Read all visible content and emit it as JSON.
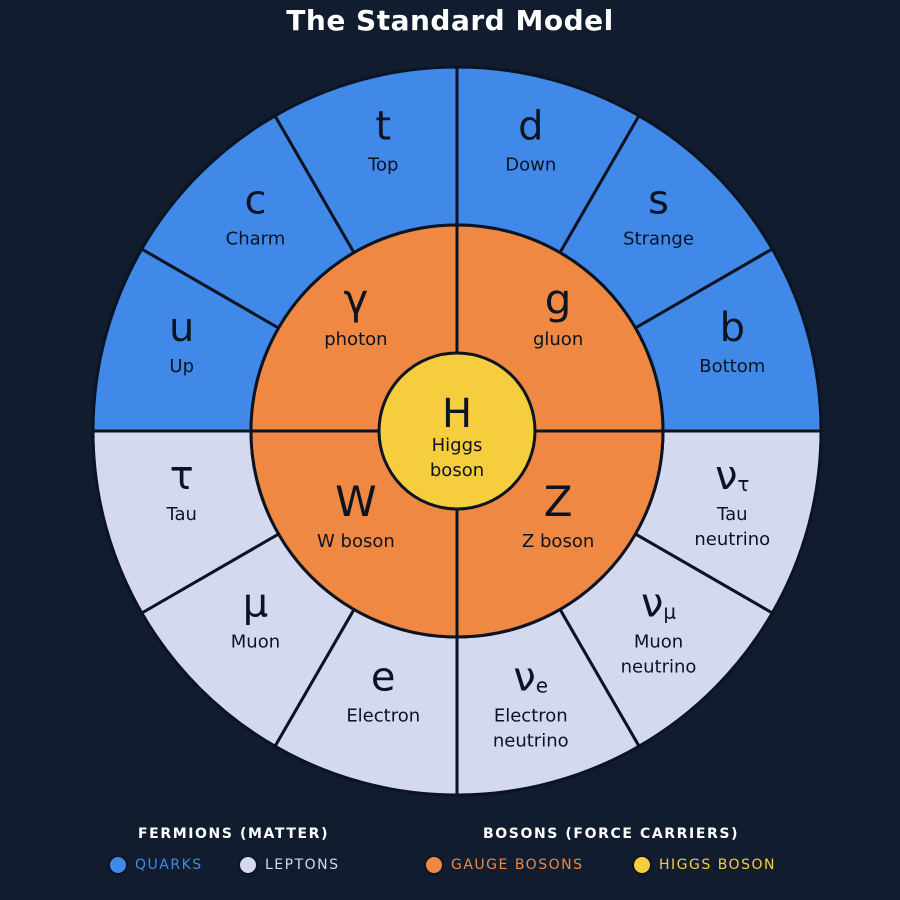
{
  "title": "The Standard Model",
  "colors": {
    "background": "#111d2e",
    "quark": "#4189e8",
    "lepton": "#d4d9f0",
    "gauge": "#ef8843",
    "higgs": "#f6cd3d",
    "stroke": "#0b1422",
    "text": "#0b1422"
  },
  "quarks": [
    {
      "symbol": "u",
      "sub": "",
      "name": [
        "Up"
      ]
    },
    {
      "symbol": "c",
      "sub": "",
      "name": [
        "Charm"
      ]
    },
    {
      "symbol": "t",
      "sub": "",
      "name": [
        "Top"
      ]
    },
    {
      "symbol": "d",
      "sub": "",
      "name": [
        "Down"
      ]
    },
    {
      "symbol": "s",
      "sub": "",
      "name": [
        "Strange"
      ]
    },
    {
      "symbol": "b",
      "sub": "",
      "name": [
        "Bottom"
      ]
    }
  ],
  "leptons": [
    {
      "symbol": "ν",
      "sub": "τ",
      "name": [
        "Tau",
        "neutrino"
      ]
    },
    {
      "symbol": "ν",
      "sub": "μ",
      "name": [
        "Muon",
        "neutrino"
      ]
    },
    {
      "symbol": "ν",
      "sub": "e",
      "name": [
        "Electron",
        "neutrino"
      ]
    },
    {
      "symbol": "e",
      "sub": "",
      "name": [
        "Electron"
      ]
    },
    {
      "symbol": "μ",
      "sub": "",
      "name": [
        "Muon"
      ]
    },
    {
      "symbol": "τ",
      "sub": "",
      "name": [
        "Tau"
      ]
    }
  ],
  "gauge_bosons": [
    {
      "symbol": "γ",
      "name": "photon"
    },
    {
      "symbol": "g",
      "name": "gluon"
    },
    {
      "symbol": "Z",
      "name": "Z boson"
    },
    {
      "symbol": "W",
      "name": "W boson"
    }
  ],
  "higgs": {
    "symbol": "H",
    "name": [
      "Higgs",
      "boson"
    ]
  },
  "legend": {
    "fermions_heading": "FERMIONS (MATTER)",
    "bosons_heading": "BOSONS (FORCE CARRIERS)",
    "quarks_label": "QUARKS",
    "leptons_label": "LEPTONS",
    "gauge_label": "GAUGE BOSONS",
    "higgs_label": "HIGGS BOSON"
  }
}
